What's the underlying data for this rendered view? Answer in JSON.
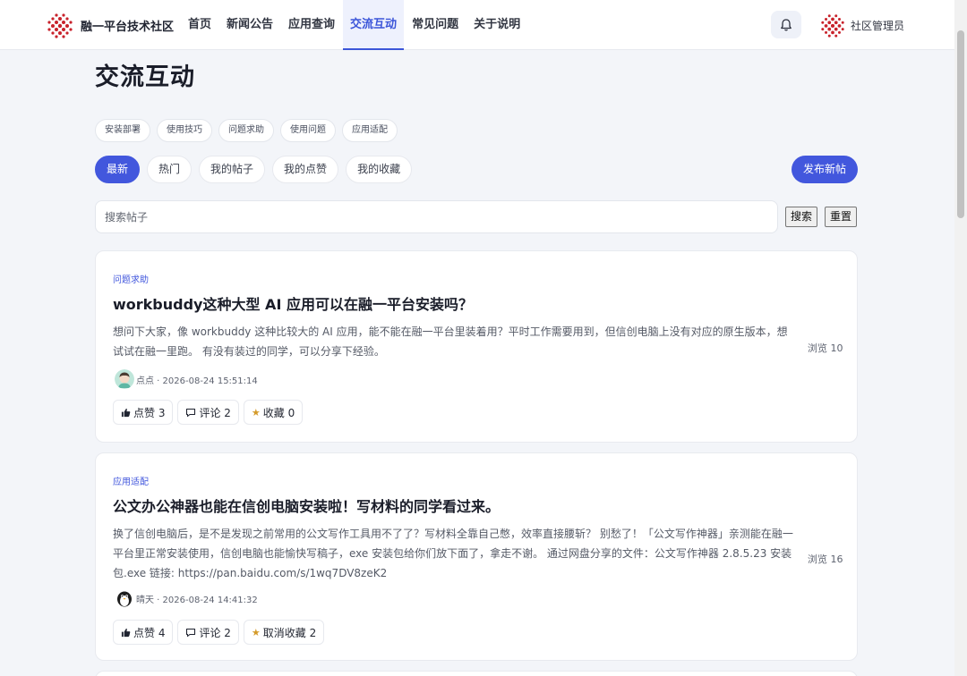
{
  "header": {
    "brand_title": "融一平台技术社区",
    "nav": [
      "首页",
      "新闻公告",
      "应用查询",
      "交流互动",
      "常见问题",
      "关于说明"
    ],
    "user_name": "社区管理员"
  },
  "page": {
    "title": "交流互动",
    "category_tags": [
      "安装部署",
      "使用技巧",
      "问题求助",
      "使用问题",
      "应用适配"
    ],
    "filter_tabs": [
      "最新",
      "热门",
      "我的帖子",
      "我的点赞",
      "我的收藏"
    ],
    "publish_label": "发布新帖"
  },
  "search": {
    "placeholder": "搜索帖子",
    "search_label": "搜索",
    "reset_label": "重置"
  },
  "posts": [
    {
      "category": "问题求助",
      "title": "workbuddy这种大型 AI 应用可以在融一平台安装吗？",
      "excerpt": "想问下大家，像 workbuddy 这种比较大的 AI 应用，能不能在融一平台里装着用？平时工作需要用到，但信创电脑上没有对应的原生版本，想试试在融一里跑。 有没有装过的同学，可以分享下经验。",
      "views": "浏览 10",
      "author_meta": "点点 · 2026-08-24 15:51:14",
      "like": "点赞 3",
      "comment": "评论 2",
      "collect": "收藏 0"
    },
    {
      "category": "应用适配",
      "title": "公文办公神器也能在信创电脑安装啦！写材料的同学看过来。",
      "excerpt": "换了信创电脑后，是不是发现之前常用的公文写作工具用不了了？写材料全靠自己憋，效率直接腰斩？ 别愁了！「公文写作神器」亲测能在融一平台里正常安装使用，信创电脑也能愉快写稿子，exe 安装包给你们放下面了，拿走不谢。 通过网盘分享的文件：公文写作神器 2.8.5.23 安装包.exe 链接: https://pan.baidu.com/s/1wq7DV8zeK2",
      "views": "浏览 16",
      "author_meta": "晴天 · 2026-08-24 14:41:32",
      "like": "点赞 4",
      "comment": "评论 2",
      "collect": "取消收藏 2"
    }
  ],
  "colors": {
    "accent": "#4257dd",
    "brand_red": "#c8222b",
    "page_bg": "#f3f5f9"
  },
  "icons": [
    "logo-dots-icon",
    "bell-icon",
    "thumbs-up-icon",
    "comment-icon",
    "star-icon"
  ]
}
